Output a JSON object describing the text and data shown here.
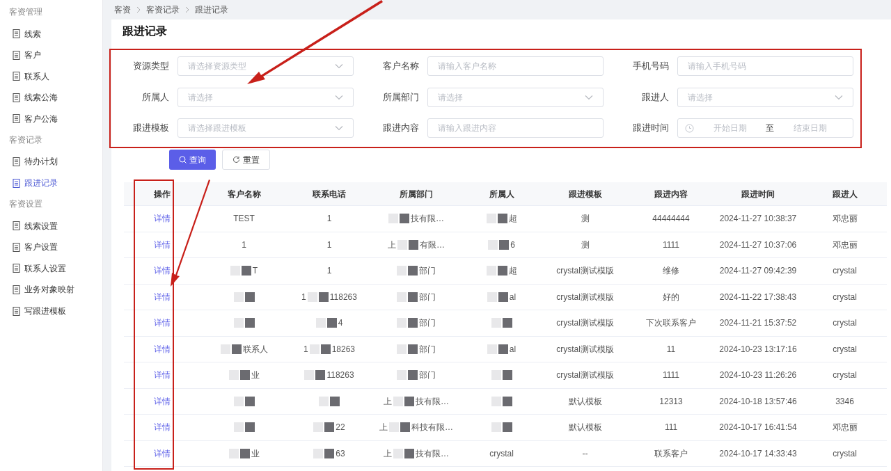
{
  "sidebar": {
    "groups": [
      {
        "title": "客资管理",
        "items": [
          {
            "label": "线索",
            "selected": false
          },
          {
            "label": "客户",
            "selected": false
          },
          {
            "label": "联系人",
            "selected": false
          },
          {
            "label": "线索公海",
            "selected": false
          },
          {
            "label": "客户公海",
            "selected": false
          }
        ]
      },
      {
        "title": "客资记录",
        "items": [
          {
            "label": "待办计划",
            "selected": false
          },
          {
            "label": "跟进记录",
            "selected": true
          }
        ]
      },
      {
        "title": "客资设置",
        "items": [
          {
            "label": "线索设置",
            "selected": false
          },
          {
            "label": "客户设置",
            "selected": false
          },
          {
            "label": "联系人设置",
            "selected": false
          },
          {
            "label": "业务对象映射",
            "selected": false
          },
          {
            "label": "写跟进模板",
            "selected": false
          }
        ]
      }
    ]
  },
  "breadcrumb": [
    "客资",
    "客资记录",
    "跟进记录"
  ],
  "page_title": "跟进记录",
  "filters": [
    {
      "label": "资源类型",
      "kind": "select",
      "placeholder": "请选择资源类型"
    },
    {
      "label": "客户名称",
      "kind": "input",
      "placeholder": "请输入客户名称"
    },
    {
      "label": "手机号码",
      "kind": "input",
      "placeholder": "请输入手机号码"
    },
    {
      "label": "所属人",
      "kind": "select",
      "placeholder": "请选择"
    },
    {
      "label": "所属部门",
      "kind": "select",
      "placeholder": "请选择"
    },
    {
      "label": "跟进人",
      "kind": "select",
      "placeholder": "请选择"
    },
    {
      "label": "跟进模板",
      "kind": "select",
      "placeholder": "请选择跟进模板"
    },
    {
      "label": "跟进内容",
      "kind": "input",
      "placeholder": "请输入跟进内容"
    },
    {
      "label": "跟进时间",
      "kind": "daterange",
      "start_placeholder": "开始日期",
      "separator": "至",
      "end_placeholder": "结束日期"
    }
  ],
  "buttons": {
    "search": "查询",
    "reset": "重置"
  },
  "table": {
    "columns": [
      "操作",
      "客户名称",
      "联系电话",
      "所属部门",
      "所属人",
      "跟进模板",
      "跟进内容",
      "跟进时间",
      "跟进人"
    ],
    "rows": [
      {
        "action": "详情",
        "customer": {
          "text": "TEST",
          "redacted": false
        },
        "phone": {
          "text": "1",
          "redacted": false
        },
        "department": {
          "text": "技有限…",
          "redacted": true
        },
        "owner": {
          "text": "超",
          "redacted": true
        },
        "template": "测",
        "content": "44444444",
        "time": "2024-11-27 10:38:37",
        "follower": "邓忠丽"
      },
      {
        "action": "详情",
        "customer": {
          "text": "1",
          "redacted": false
        },
        "phone": {
          "text": "1",
          "redacted": false
        },
        "department": {
          "lead": "上",
          "text": "有限…",
          "redacted": true
        },
        "owner": {
          "text": "6",
          "redacted": true
        },
        "template": "测",
        "content": "1111",
        "time": "2024-11-27 10:37:06",
        "follower": "邓忠丽"
      },
      {
        "action": "详情",
        "customer": {
          "text": "T",
          "redacted": true
        },
        "phone": {
          "text": "1",
          "redacted": false
        },
        "department": {
          "text": "部门",
          "redacted": true
        },
        "owner": {
          "text": "超",
          "redacted": true
        },
        "template": "crystal测试模版",
        "content": "维修",
        "time": "2024-11-27 09:42:39",
        "follower": "crystal"
      },
      {
        "action": "详情",
        "customer": {
          "redacted": true
        },
        "phone": {
          "lead": "1",
          "text": "118263",
          "redacted": true
        },
        "department": {
          "text": "部门",
          "redacted": true
        },
        "owner": {
          "text": "al",
          "redacted": true
        },
        "template": "crystal测试模版",
        "content": "好的",
        "time": "2024-11-22 17:38:43",
        "follower": "crystal"
      },
      {
        "action": "详情",
        "customer": {
          "redacted": true
        },
        "phone": {
          "text": "4",
          "redacted": true
        },
        "department": {
          "text": "部门",
          "redacted": true
        },
        "owner": {
          "redacted": true
        },
        "template": "crystal测试模版",
        "content": "下次联系客户",
        "time": "2024-11-21 15:37:52",
        "follower": "crystal"
      },
      {
        "action": "详情",
        "customer": {
          "text": "联系人",
          "redacted": true
        },
        "phone": {
          "lead": "1",
          "text": "18263",
          "redacted": true
        },
        "department": {
          "text": "部门",
          "redacted": true
        },
        "owner": {
          "text": "al",
          "redacted": true
        },
        "template": "crystal测试模版",
        "content": "11",
        "time": "2024-10-23 13:17:16",
        "follower": "crystal"
      },
      {
        "action": "详情",
        "customer": {
          "text": "业",
          "redacted": true
        },
        "phone": {
          "text": "118263",
          "redacted": true
        },
        "department": {
          "text": "部门",
          "redacted": true
        },
        "owner": {
          "redacted": true
        },
        "template": "crystal测试模版",
        "content": "1111",
        "time": "2024-10-23 11:26:26",
        "follower": "crystal"
      },
      {
        "action": "详情",
        "customer": {
          "redacted": true
        },
        "phone": {
          "redacted": true
        },
        "department": {
          "lead": "上",
          "text": "技有限…",
          "redacted": true
        },
        "owner": {
          "redacted": true
        },
        "template": "默认模板",
        "content": "12313",
        "time": "2024-10-18 13:57:46",
        "follower": "3346"
      },
      {
        "action": "详情",
        "customer": {
          "redacted": true
        },
        "phone": {
          "text": "22",
          "redacted": true
        },
        "department": {
          "lead": "上",
          "text": "科技有限…",
          "redacted": true
        },
        "owner": {
          "redacted": true
        },
        "template": "默认模板",
        "content": "111",
        "time": "2024-10-17 16:41:54",
        "follower": "邓忠丽"
      },
      {
        "action": "详情",
        "customer": {
          "text": "业",
          "redacted": true
        },
        "phone": {
          "text": "63",
          "redacted": true
        },
        "department": {
          "lead": "上",
          "text": "技有限…",
          "redacted": true
        },
        "owner": {
          "text": "crystal",
          "redacted": false
        },
        "template": "--",
        "content": "联系客户",
        "time": "2024-10-17 14:33:43",
        "follower": "crystal"
      }
    ]
  }
}
